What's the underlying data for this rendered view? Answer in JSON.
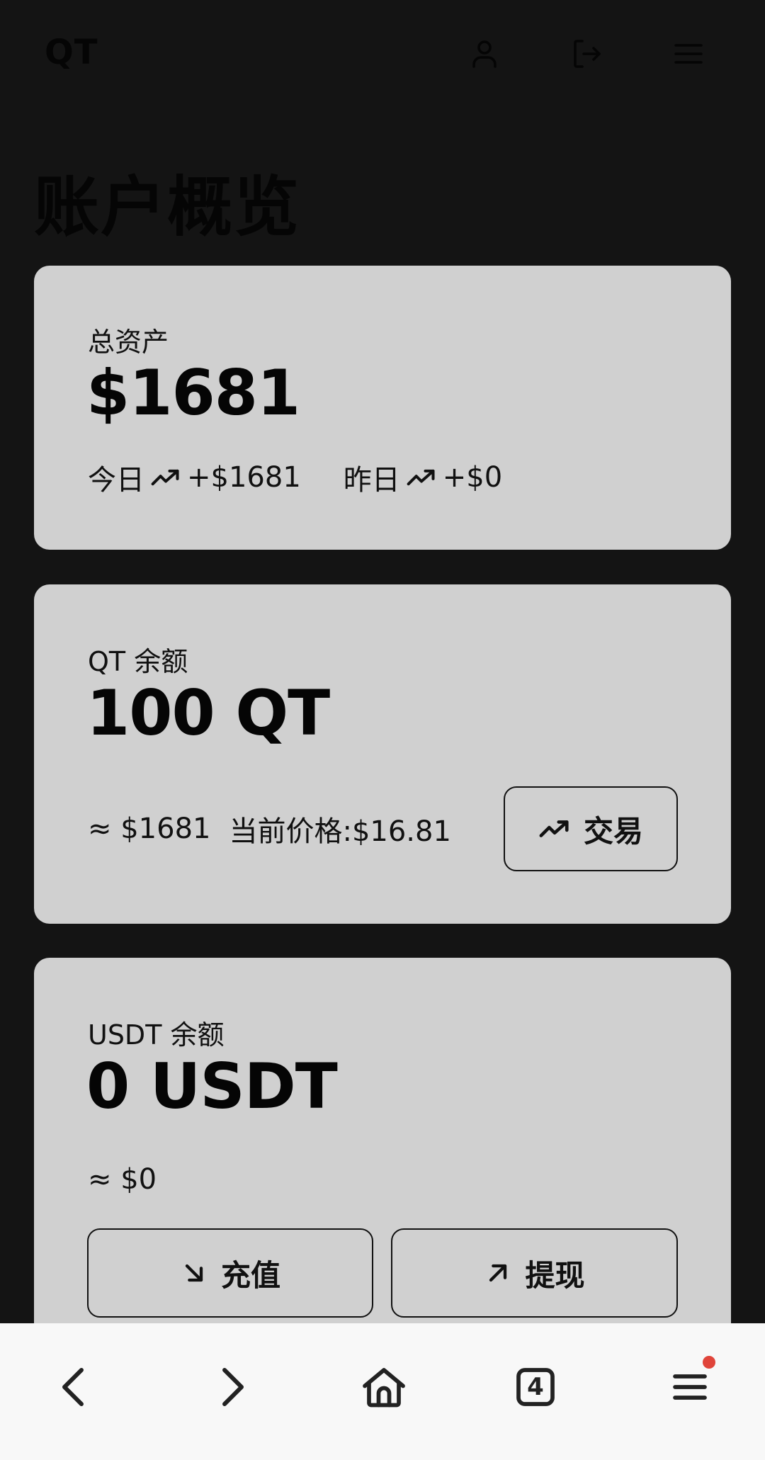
{
  "header": {
    "logo": "QT",
    "page_title": "账户概览"
  },
  "total_assets": {
    "label": "总资产",
    "value": "$1681",
    "today_label": "今日",
    "today_change": "+$1681",
    "yesterday_label": "昨日",
    "yesterday_change": "+$0"
  },
  "qt_balance": {
    "label": "QT 余额",
    "value": "100 QT",
    "usd_equivalent": "≈ $1681",
    "current_price": "当前价格:$16.81",
    "trade_button": "交易"
  },
  "usdt_balance": {
    "label": "USDT 余额",
    "value": "0 USDT",
    "usd_equivalent": "≈ $0",
    "deposit_button": "充值",
    "withdraw_button": "提现"
  },
  "browser_bar": {
    "tab_count": "4"
  },
  "icons": {
    "profile": "user-icon",
    "logout": "logout-icon",
    "menu": "hamburger-icon",
    "trend": "trending-up-icon",
    "deposit": "arrow-down-right-icon",
    "withdraw": "arrow-up-right-icon",
    "back": "chevron-left-icon",
    "forward": "chevron-right-icon",
    "home": "home-icon",
    "tabs": "tabs-icon"
  },
  "colors": {
    "background": "#141414",
    "card": "#d0d0d0",
    "notification_dot": "#e0443a"
  }
}
